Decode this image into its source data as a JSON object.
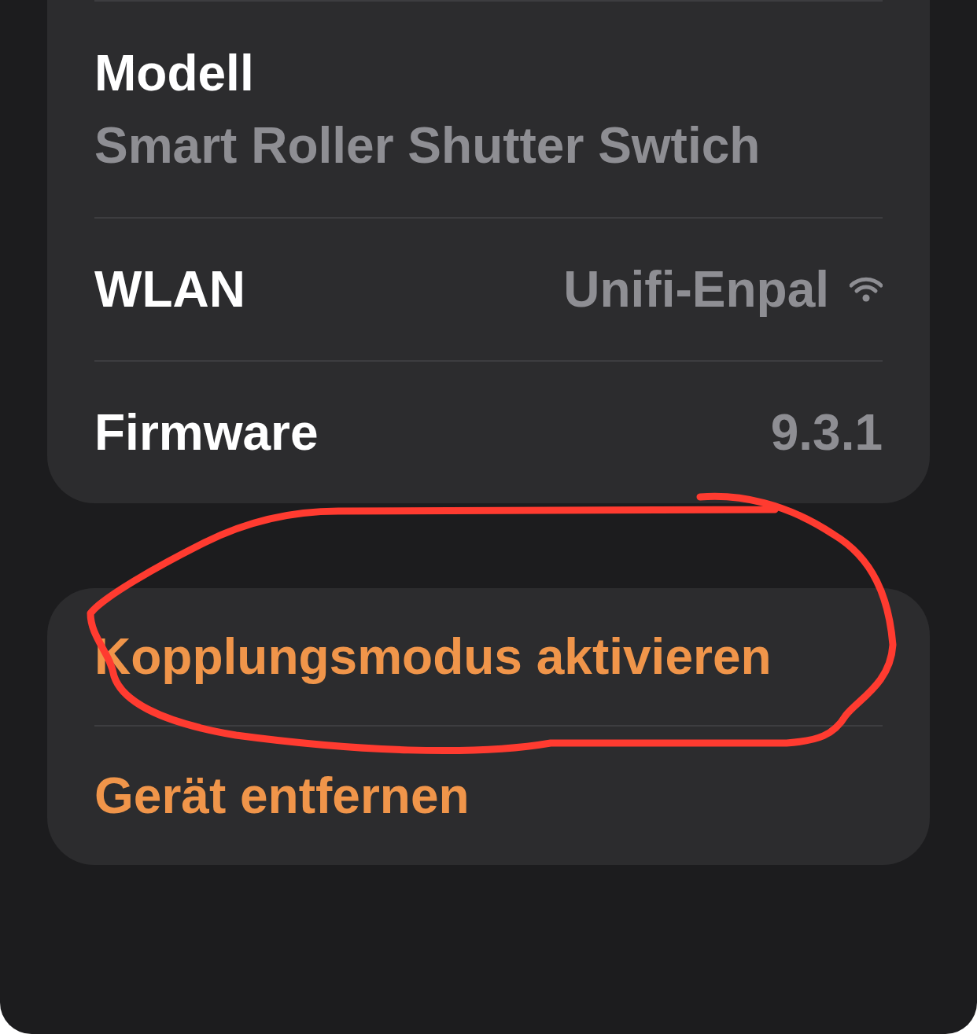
{
  "details": [
    {
      "kind": "stacked",
      "label": "Modell",
      "value": "Smart Roller Shutter Swtich"
    },
    {
      "kind": "inline",
      "label": "WLAN",
      "value": "Unifi-Enpal",
      "wifi": true
    },
    {
      "kind": "inline",
      "label": "Firmware",
      "value": "9.3.1"
    }
  ],
  "actions": [
    {
      "label": "Kopplungsmodus aktivieren"
    },
    {
      "label": "Gerät entfernen"
    }
  ]
}
